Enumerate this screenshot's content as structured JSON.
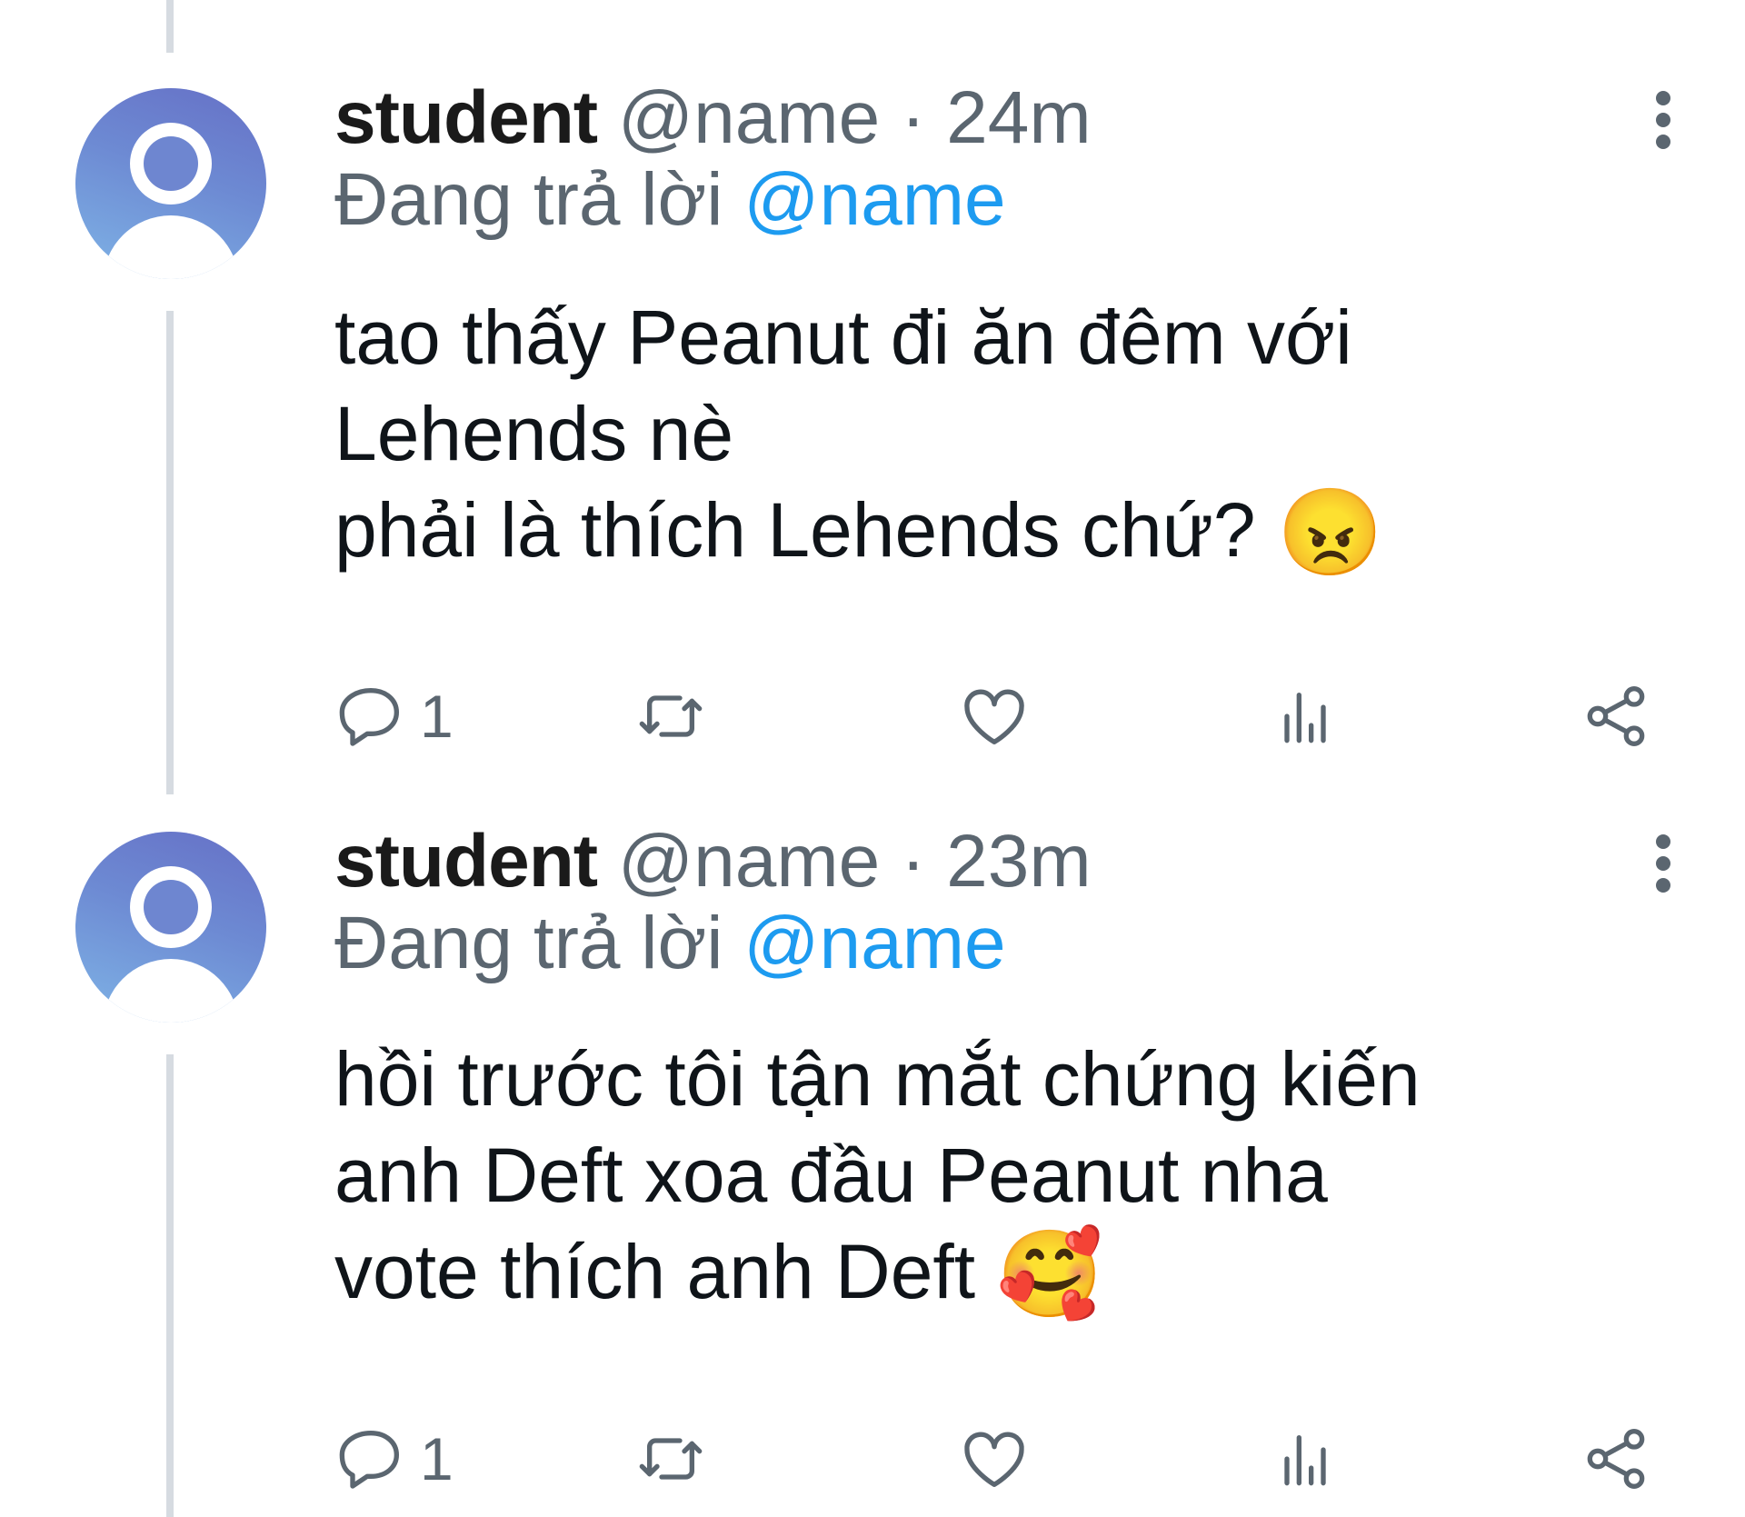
{
  "tweets": [
    {
      "display_name": "student",
      "handle": "@name",
      "separator": "·",
      "time": "24m",
      "reply_prefix": "Đang trả lời",
      "reply_to": "@name",
      "lines": [
        "tao thấy Peanut đi ăn đêm với",
        "Lehends nè",
        "phải là thích Lehends chứ?"
      ],
      "emoji": "😠",
      "reply_count": "1"
    },
    {
      "display_name": "student",
      "handle": "@name",
      "separator": "·",
      "time": "23m",
      "reply_prefix": "Đang trả lời",
      "reply_to": "@name",
      "lines": [
        "hồi trước tôi tận mắt chứng kiến",
        "anh Deft xoa đầu Peanut nha",
        "vote thích anh Deft"
      ],
      "emoji": "🥰",
      "reply_count": "1"
    }
  ],
  "icons": {
    "avatar": "default-avatar-icon",
    "more": "more-vertical-icon",
    "reply": "reply-icon",
    "retweet": "retweet-icon",
    "like": "heart-icon",
    "views": "views-icon",
    "share": "share-icon"
  },
  "colors": {
    "link": "#1d9bf0",
    "muted": "#5b6670",
    "text": "#0f1419",
    "thread_line": "#d6dbe1"
  }
}
